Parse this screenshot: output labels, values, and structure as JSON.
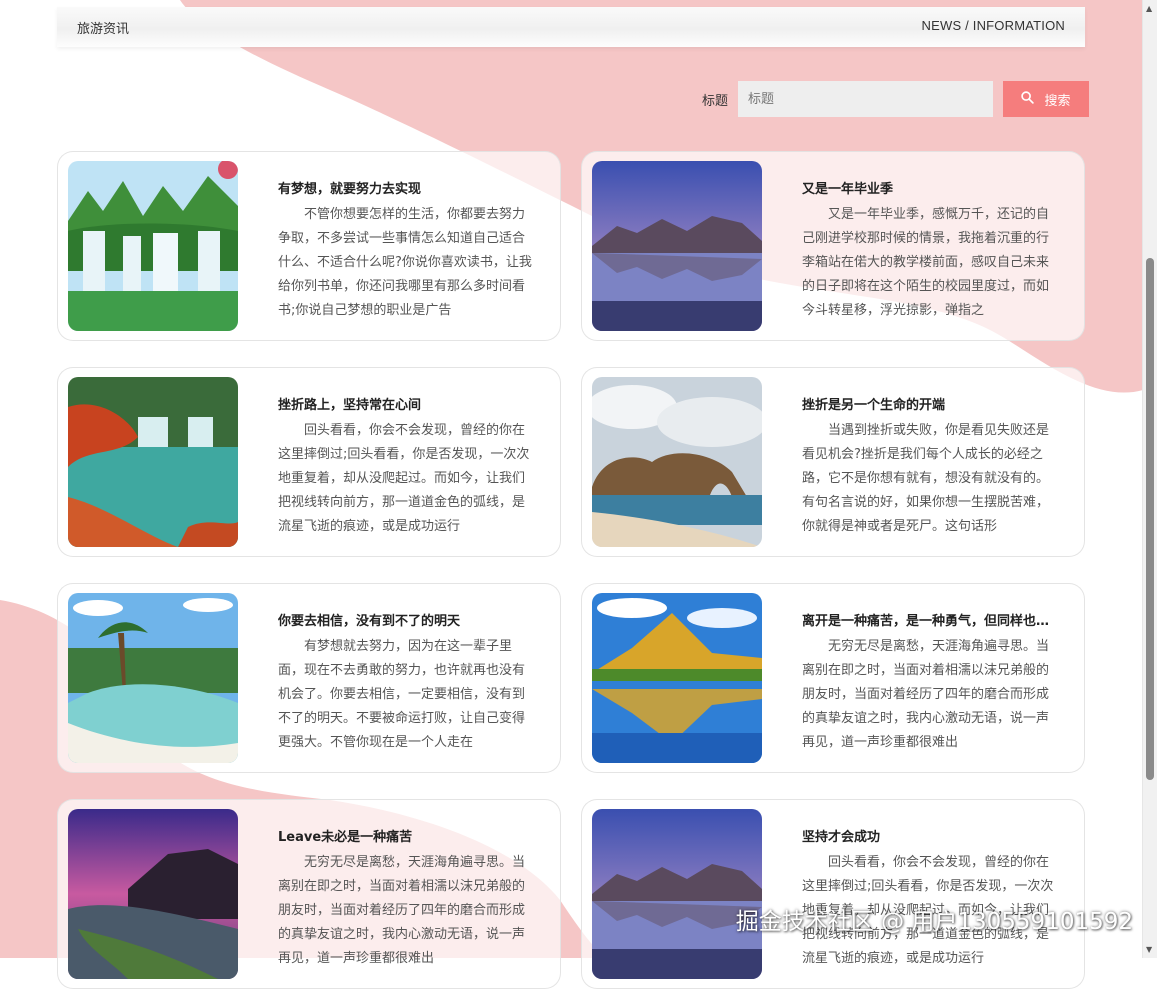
{
  "header": {
    "title": "旅游资讯",
    "subtitle": "NEWS / INFORMATION"
  },
  "search": {
    "label": "标题",
    "placeholder": "标题",
    "button_label": "搜索"
  },
  "colors": {
    "accent": "#f57d7d",
    "background_blob": "#f5c6c6"
  },
  "cards": [
    {
      "title": "有梦想，就要努力去实现",
      "text": "不管你想要怎样的生活，你都要去努力争取，不多尝试一些事情怎么知道自己适合什么、不适合什么呢?你说你喜欢读书，让我给你列书单，你还问我哪里有那么多时间看书;你说自己梦想的职业是广告",
      "image": "waterfall"
    },
    {
      "title": "又是一年毕业季",
      "text": "又是一年毕业季，感慨万千，还记的自己刚进学校那时候的情景，我拖着沉重的行李箱站在偌大的教学楼前面，感叹自己未来的日子即将在这个陌生的校园里度过，而如今斗转星移，浮光掠影，弹指之",
      "image": "mountain-lake"
    },
    {
      "title": "挫折路上，坚持常在心间",
      "text": "回头看看，你会不会发现，曾经的你在这里摔倒过;回头看看，你是否发现，一次次地重复着，却从没爬起过。而如今，让我们把视线转向前方，那一道道金色的弧线，是流星飞逝的痕迹，或是成功运行",
      "image": "autumn-waterfall"
    },
    {
      "title": "挫折是另一个生命的开端",
      "text": "当遇到挫折或失败，你是看见失败还是看见机会?挫折是我们每个人成长的必经之路，它不是你想有就有，想没有就没有的。有句名言说的好，如果你想一生摆脱苦难，你就得是神或者是死尸。这句话形",
      "image": "rock-arch"
    },
    {
      "title": "你要去相信，没有到不了的明天",
      "text": "有梦想就去努力，因为在这一辈子里面，现在不去勇敢的努力，也许就再也没有机会了。你要去相信，一定要相信，没有到不了的明天。不要被命运打败，让自己变得更强大。不管你现在是一个人走在",
      "image": "tropical-beach"
    },
    {
      "title": "离开是一种痛苦，是一种勇气，但同样也是一个考验",
      "text": "无穷无尽是离愁，天涯海角遍寻思。当离别在即之时，当面对着相濡以沫兄弟般的朋友时，当面对着经历了四年的磨合而形成的真挚友谊之时，我内心激动无语，说一声再见，道一声珍重都很难出",
      "image": "golden-mountain"
    },
    {
      "title": "Leave未必是一种痛苦",
      "text": "无穷无尽是离愁，天涯海角遍寻思。当离别在即之时，当面对着相濡以沫兄弟般的朋友时，当面对着经历了四年的磨合而形成的真挚友谊之时，我内心激动无语，说一声再见，道一声珍重都很难出",
      "image": "purple-coast"
    },
    {
      "title": "坚持才会成功",
      "text": "回头看看，你会不会发现，曾经的你在这里摔倒过;回头看看，你是否发现，一次次地重复着，却从没爬起过。而如今，让我们把视线转向前方，那一道道金色的弧线，是流星飞逝的痕迹，或是成功运行",
      "image": "mountain-lake"
    }
  ],
  "watermark": "掘金技术社区 @ 用户130559101592"
}
